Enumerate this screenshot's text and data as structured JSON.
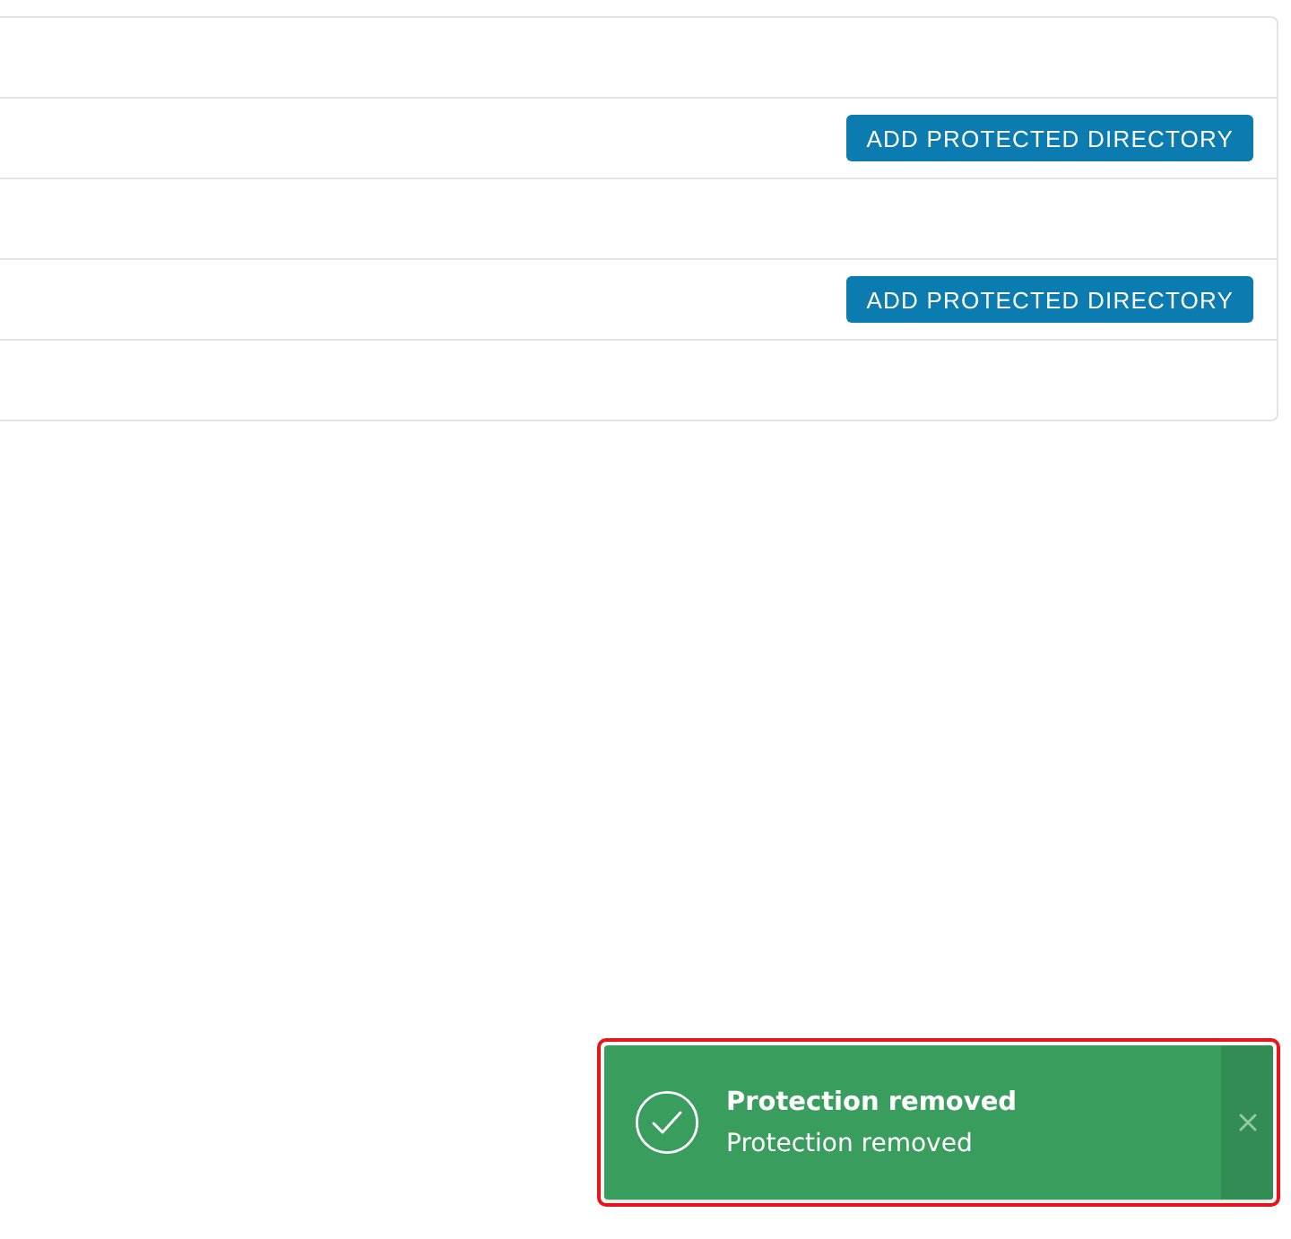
{
  "table": {
    "rows": [
      {
        "kind": "blank"
      },
      {
        "kind": "action",
        "button": "ADD PROTECTED DIRECTORY"
      },
      {
        "kind": "blank"
      },
      {
        "kind": "action",
        "button": "ADD PROTECTED DIRECTORY"
      },
      {
        "kind": "blank"
      }
    ]
  },
  "toast": {
    "title": "Protection removed",
    "message": "Protection removed",
    "highlighted": true
  }
}
